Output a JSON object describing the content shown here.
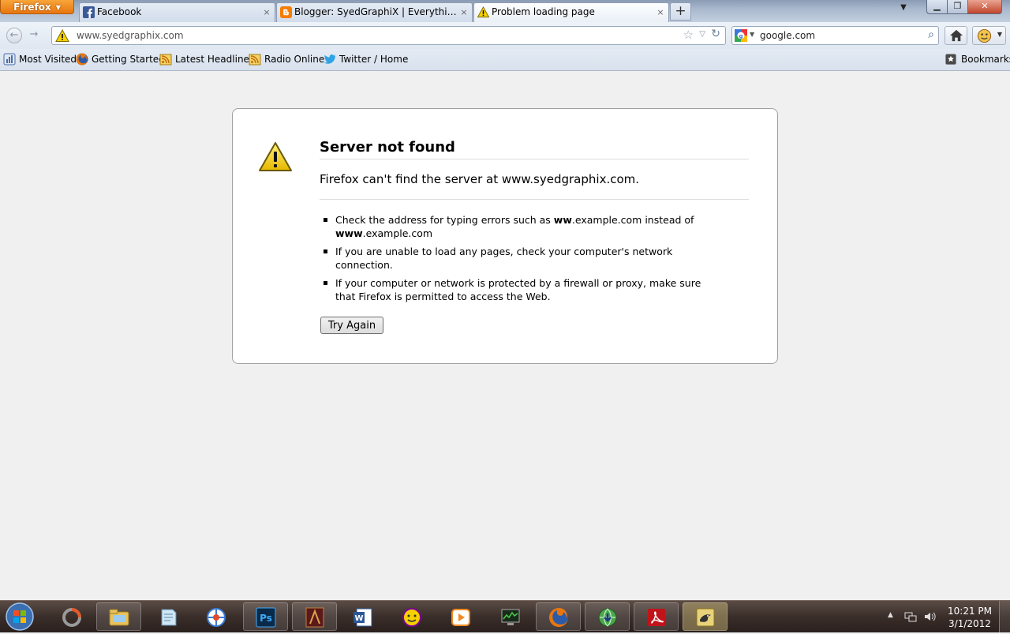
{
  "window": {
    "menu_label": "Firefox",
    "tabs": [
      {
        "title": "Facebook",
        "icon": "facebook-icon"
      },
      {
        "title": "Blogger: SyedGraphiX | Everything in ...",
        "icon": "blogger-icon"
      },
      {
        "title": "Problem loading page",
        "icon": "warning-icon",
        "active": true
      }
    ],
    "new_tab": "+",
    "tab_close": "×"
  },
  "navigation": {
    "url": "www.syedgraphix.com",
    "search_value": "google.com",
    "search_engine_icon": "google-icon"
  },
  "bookmarks": {
    "items": [
      {
        "label": "Most Visited",
        "icon": "most-visited-icon"
      },
      {
        "label": "Getting Started",
        "icon": "firefox-icon"
      },
      {
        "label": "Latest Headlines",
        "icon": "rss-icon"
      },
      {
        "label": "Radio Online",
        "icon": "rss-icon"
      },
      {
        "label": "Twitter / Home",
        "icon": "twitter-icon"
      }
    ],
    "menu_label": "Bookmarks"
  },
  "error_page": {
    "title": "Server not found",
    "short_desc": "Firefox can't find the server at www.syedgraphix.com.",
    "tips": [
      {
        "pre": "Check the address for typing errors such as ",
        "bold1": "ww",
        "mid": ".example.com instead of ",
        "bold2": "www",
        "post": ".example.com"
      },
      {
        "text": "If you are unable to load any pages, check your computer's network connection."
      },
      {
        "text": "If your computer or network is protected by a firewall or proxy, make sure that Firefox is permitted to access the Web."
      }
    ],
    "button_label": "Try Again"
  },
  "taskbar": {
    "apps": [
      "explorer",
      "notes",
      "media-center",
      "photoshop",
      "game",
      "word",
      "yahoo-messenger",
      "media-player",
      "system-monitor",
      "firefox",
      "internet-download-manager",
      "adobe-reader",
      "pidgin"
    ],
    "clock_time": "10:21 PM",
    "clock_date": "3/1/2012"
  },
  "colors": {
    "firefox_orange": "#e8760f",
    "warning_yellow": "#f5d200",
    "page_bg": "#f0f0f0"
  }
}
